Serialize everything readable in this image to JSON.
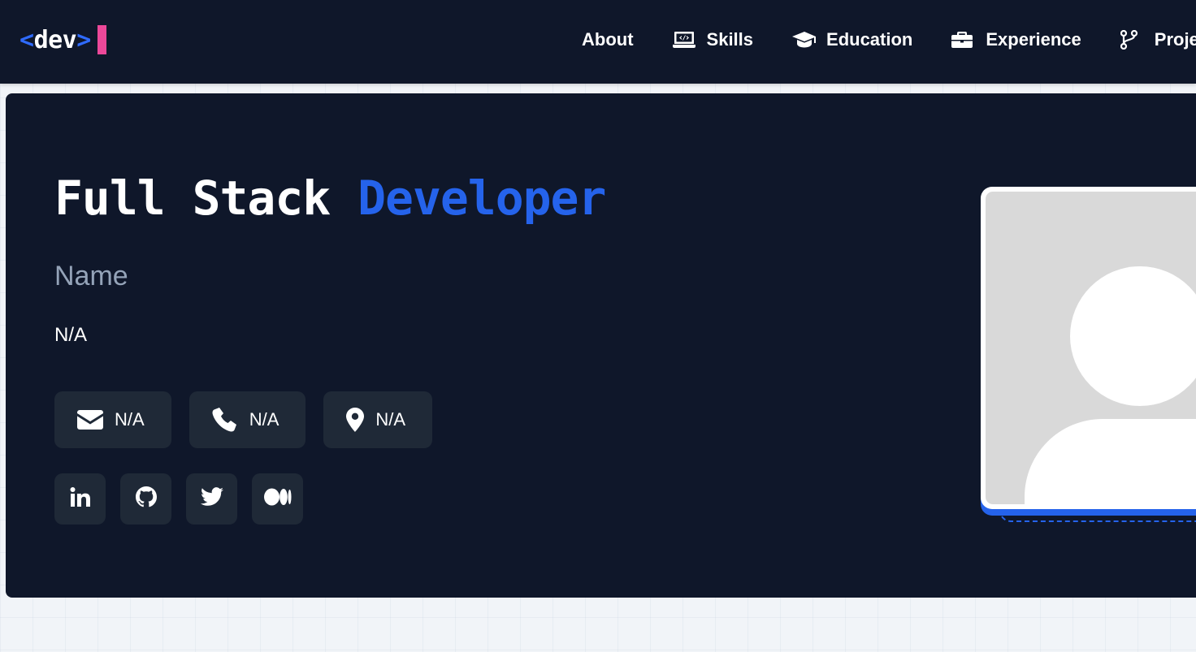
{
  "logo": {
    "open": "<",
    "word": "dev",
    "close": ">"
  },
  "nav": {
    "items": [
      {
        "label": "About",
        "icon": "none"
      },
      {
        "label": "Skills",
        "icon": "laptop-code-icon"
      },
      {
        "label": "Education",
        "icon": "graduation-cap-icon"
      },
      {
        "label": "Experience",
        "icon": "briefcase-icon"
      },
      {
        "label": "Projects",
        "icon": "code-branch-icon"
      }
    ]
  },
  "hero": {
    "title_part1": "Full Stack ",
    "title_part2": "Developer",
    "name": "Name",
    "bio": "N/A",
    "contacts": [
      {
        "icon": "envelope-icon",
        "value": "N/A"
      },
      {
        "icon": "phone-icon",
        "value": "N/A"
      },
      {
        "icon": "location-pin-icon",
        "value": "N/A"
      }
    ],
    "socials": [
      {
        "icon": "linkedin-icon"
      },
      {
        "icon": "github-icon"
      },
      {
        "icon": "twitter-icon"
      },
      {
        "icon": "medium-icon"
      }
    ]
  },
  "colors": {
    "navbar_bg": "#0f172a",
    "hero_bg": "#0f172a",
    "accent_blue": "#2563eb",
    "cursor_pink": "#ec4899",
    "chip_bg": "#1f2937",
    "muted_text": "#94a3b8"
  }
}
